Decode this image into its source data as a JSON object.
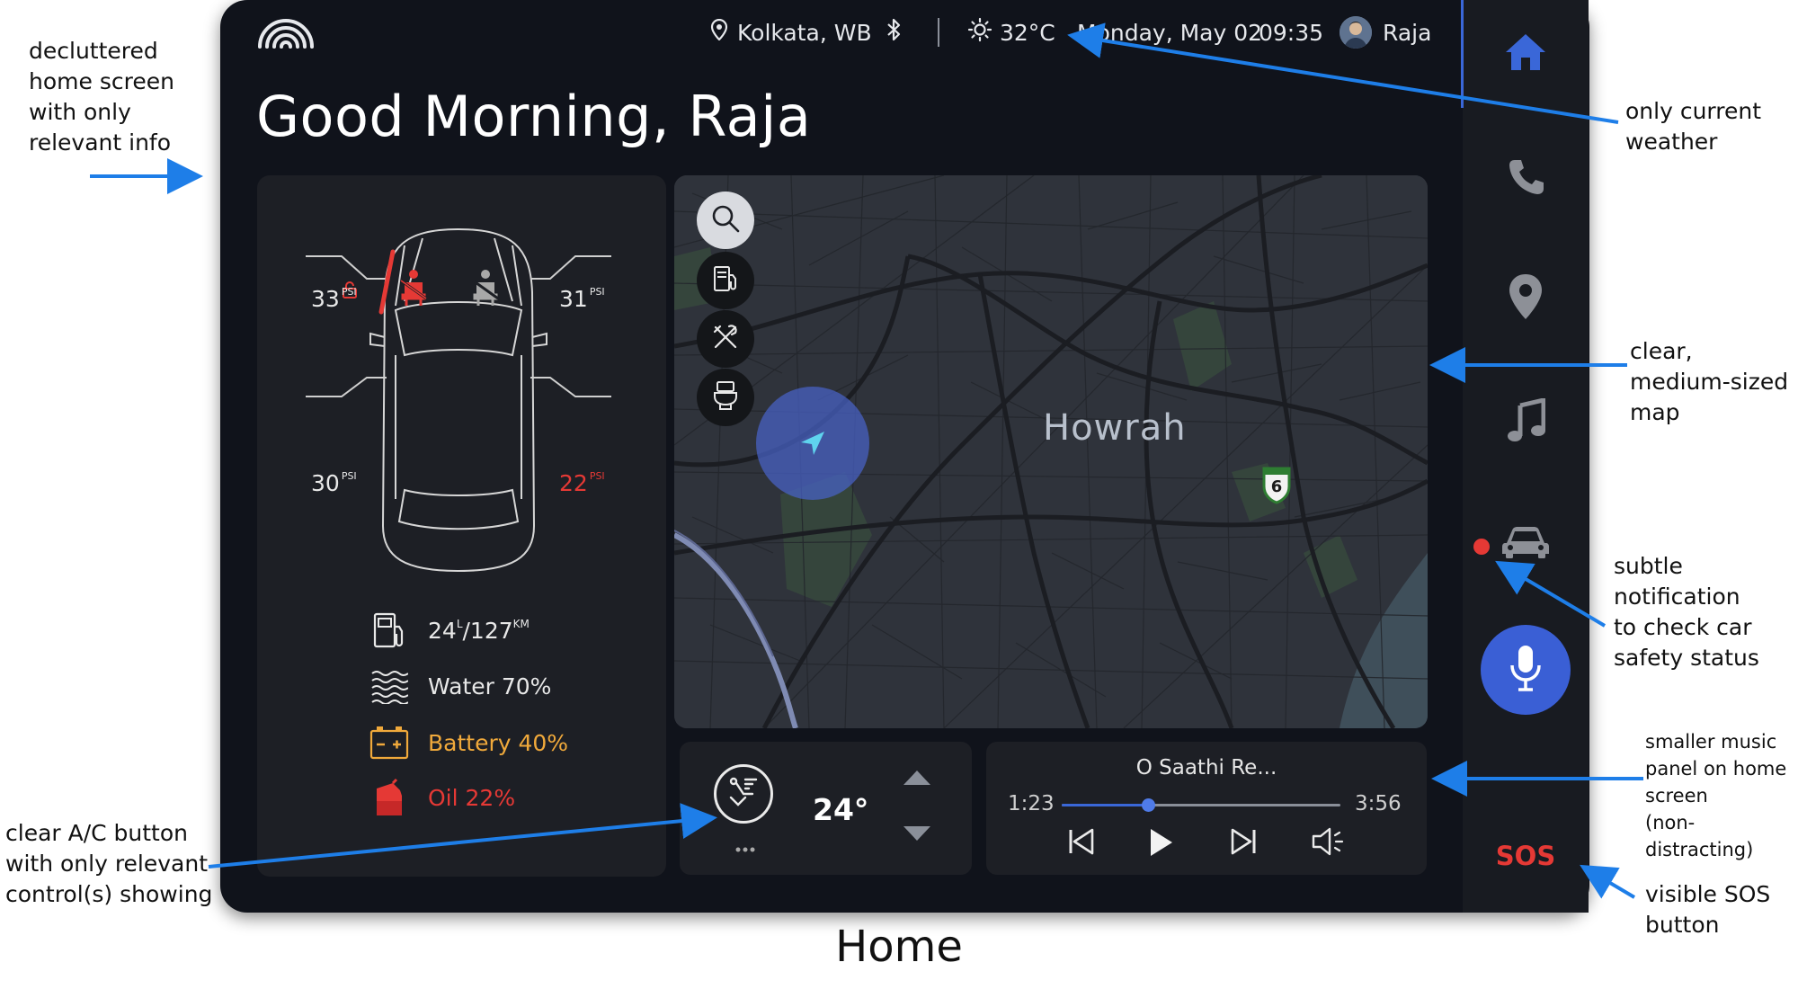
{
  "status_bar": {
    "location": "Kolkata, WB",
    "temperature": "32°C",
    "date": "Monday, May 02",
    "time": "09:35",
    "user_name": "Raja"
  },
  "greeting": "Good Morning, Raja",
  "car_status": {
    "tires": {
      "front_left": {
        "value": "33",
        "unit": "PSI"
      },
      "front_right": {
        "value": "31",
        "unit": "PSI"
      },
      "rear_left": {
        "value": "30",
        "unit": "PSI"
      },
      "rear_right": {
        "value": "22",
        "unit": "PSI"
      }
    },
    "fuel": {
      "liters": "24",
      "liters_unit": "L",
      "range": "/127",
      "range_unit": "KM"
    },
    "water": "Water 70%",
    "battery": "Battery 40%",
    "oil": "Oil 22%"
  },
  "map": {
    "label": "Howrah",
    "highway_shield": "6"
  },
  "climate": {
    "temperature": "24°"
  },
  "music": {
    "title": "O Saathi Re...",
    "elapsed": "1:23",
    "duration": "3:56",
    "progress": 0.31
  },
  "rail": {
    "items": [
      "home-icon",
      "phone-icon",
      "location-pin-icon",
      "music-note-icon",
      "car-icon"
    ],
    "sos_label": "SOS"
  },
  "annotations": {
    "decluttered": "decluttered\nhome screen\nwith only\nrelevant info",
    "weather": "only current\nweather",
    "map": "clear,\nmedium-sized\nmap",
    "car_safety": "subtle\nnotification\nto check car\nsafety status",
    "music": "smaller music\npanel on home\nscreen\n(non-distracting)",
    "sos": "visible SOS\nbutton",
    "ac": "clear A/C button\nwith only relevant\ncontrol(s) showing"
  },
  "caption": "Home",
  "colors": {
    "device_bg": "#10131b",
    "panel_bg": "#1d1f25",
    "warning_red": "#e53935",
    "battery_amber": "#f0a93b",
    "accent_blue": "#3a67d8",
    "annotation_arrow": "#1e7ee8"
  }
}
